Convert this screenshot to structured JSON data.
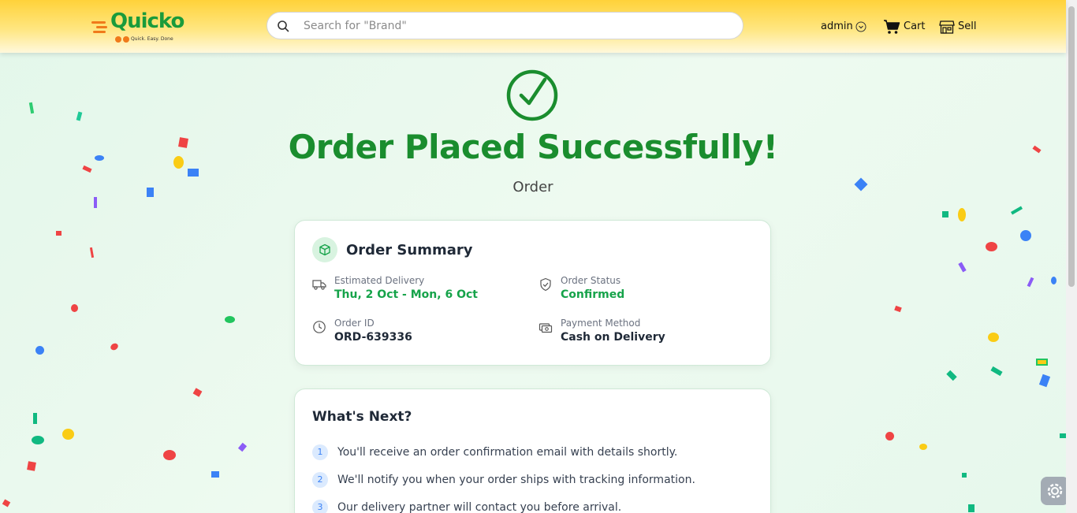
{
  "header": {
    "logo": {
      "brand": "Quicko",
      "tagline": "Quick. Easy. Done"
    },
    "search": {
      "placeholder": "Search for \"Brand\""
    },
    "nav": {
      "admin": "admin",
      "cart": "Cart",
      "sell": "Sell"
    }
  },
  "main": {
    "title": "Order Placed Successfully!",
    "subtitle": "Order",
    "summary": {
      "title": "Order Summary",
      "estimated_delivery_label": "Estimated Delivery",
      "estimated_delivery_value": "Thu, 2 Oct - Mon, 6 Oct",
      "order_status_label": "Order Status",
      "order_status_value": "Confirmed",
      "order_id_label": "Order ID",
      "order_id_value": "ORD-639336",
      "payment_method_label": "Payment Method",
      "payment_method_value": "Cash on Delivery"
    },
    "next": {
      "title": "What's Next?",
      "steps": [
        {
          "num": "1",
          "text": "You'll receive an order confirmation email with details shortly."
        },
        {
          "num": "2",
          "text": "We'll notify you when your order ships with tracking information."
        },
        {
          "num": "3",
          "text": "Our delivery partner will contact you before arrival."
        }
      ]
    }
  },
  "colors": {
    "accent_green": "#1a8d2e",
    "status_green": "#16a34a",
    "header_yellow": "#ffd23a",
    "brand_orange": "#f07a1a"
  },
  "icons": [
    "search-icon",
    "chevron-down-icon",
    "cart-icon",
    "store-icon",
    "check-circle-icon",
    "package-icon",
    "truck-icon",
    "shield-check-icon",
    "clock-icon",
    "payment-icon",
    "settings-icon"
  ]
}
